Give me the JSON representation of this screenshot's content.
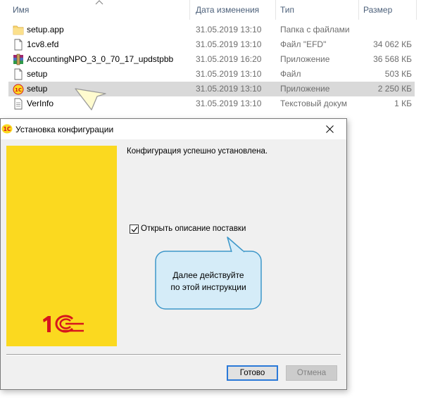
{
  "explorer": {
    "columns": {
      "name": "Имя",
      "date": "Дата изменения",
      "type": "Тип",
      "size": "Размер"
    },
    "files": [
      {
        "name": "setup.app",
        "date": "31.05.2019 13:10",
        "type": "Папка с файлами",
        "size": "",
        "icon": "folder-icon"
      },
      {
        "name": "1cv8.efd",
        "date": "31.05.2019 13:10",
        "type": "Файл \"EFD\"",
        "size": "34 062 КБ",
        "icon": "file-icon"
      },
      {
        "name": "AccountingNPO_3_0_70_17_updstpbb",
        "date": "31.05.2019 16:20",
        "type": "Приложение",
        "size": "36 568 КБ",
        "icon": "archive-app-icon"
      },
      {
        "name": "setup",
        "date": "31.05.2019 13:10",
        "type": "Файл",
        "size": "503 КБ",
        "icon": "file-icon"
      },
      {
        "name": "setup",
        "date": "31.05.2019 13:10",
        "type": "Приложение",
        "size": "2 250 КБ",
        "icon": "1c-app-icon",
        "selected": true
      },
      {
        "name": "VerInfo",
        "date": "31.05.2019 13:10",
        "type": "Текстовый докум",
        "size": "1 КБ",
        "icon": "text-document-icon"
      }
    ]
  },
  "dialog": {
    "title": "Установка конфигурации",
    "message": "Конфигурация успешно установлена.",
    "checkbox": {
      "label": "Открыть описание поставки",
      "checked": true
    },
    "callout": {
      "line1": "Далее действуйте",
      "line2": "по этой инструкции"
    },
    "ok_label": "Готово",
    "cancel_label": "Отмена"
  },
  "colors": {
    "panel_yellow": "#fbd91f",
    "brand_red": "#d6161d",
    "callout_fill": "#d5ecf8",
    "callout_border": "#3d97c9",
    "pointer_fill": "#fffbcf",
    "selection": "#d9d9d9",
    "focus_blue": "#2a79d8"
  }
}
